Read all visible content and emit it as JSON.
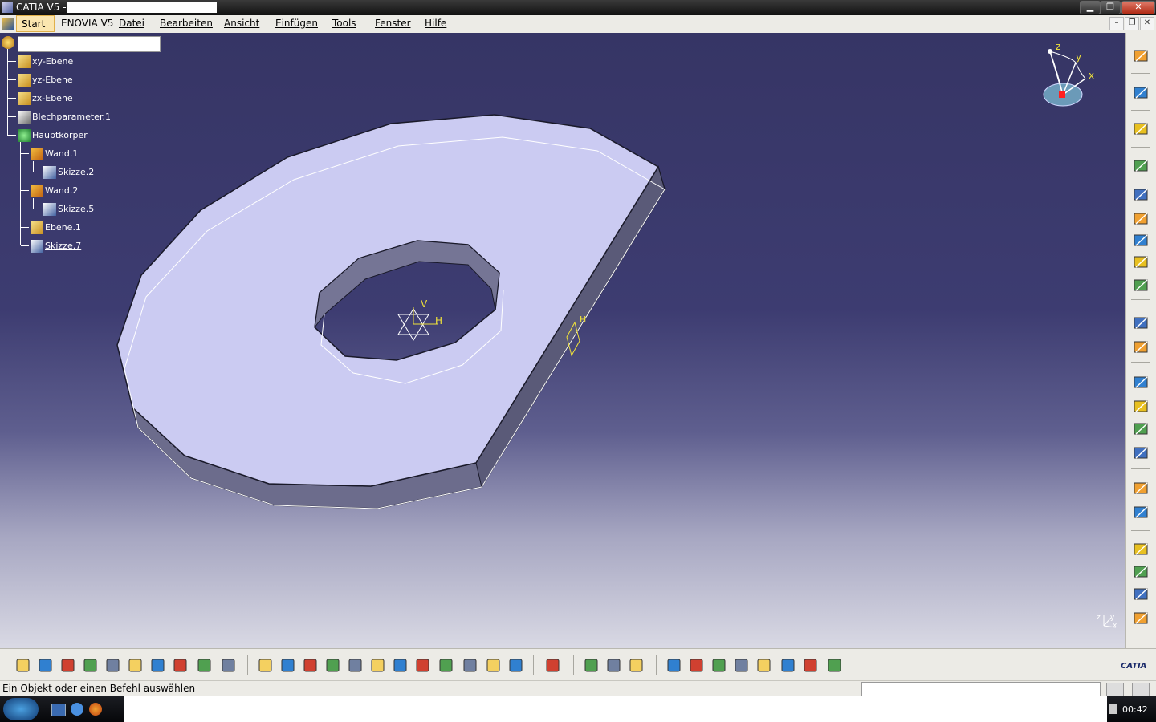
{
  "window": {
    "title": "CATIA V5 -",
    "buttons": {
      "minimize": "▁",
      "restore": "❐",
      "close": "✕"
    }
  },
  "menu": {
    "items": [
      "Start",
      "ENOVIA V5",
      "Datei",
      "Bearbeiten",
      "Ansicht",
      "Einfügen",
      "Tools",
      "Fenster",
      "Hilfe"
    ],
    "inner_buttons": [
      "–",
      "❐",
      "✕"
    ]
  },
  "tree": {
    "root_label": "",
    "items": [
      {
        "label": "xy-Ebene",
        "icon": "plane-icon",
        "level": 1
      },
      {
        "label": "yz-Ebene",
        "icon": "plane-icon",
        "level": 1
      },
      {
        "label": "zx-Ebene",
        "icon": "plane-icon",
        "level": 1
      },
      {
        "label": "Blechparameter.1",
        "icon": "sheetmetal-parameters-icon",
        "level": 1
      },
      {
        "label": "Hauptkörper",
        "icon": "body-icon",
        "level": 1
      },
      {
        "label": "Wand.1",
        "icon": "wall-icon",
        "level": 2
      },
      {
        "label": "Skizze.2",
        "icon": "sketch-icon",
        "level": 3
      },
      {
        "label": "Wand.2",
        "icon": "wall-icon",
        "level": 2
      },
      {
        "label": "Skizze.5",
        "icon": "sketch-icon",
        "level": 3
      },
      {
        "label": "Ebene.1",
        "icon": "plane-icon",
        "level": 2
      },
      {
        "label": "Skizze.7",
        "icon": "sketch-icon",
        "level": 2
      }
    ]
  },
  "compass": {
    "x": "x",
    "y": "y",
    "z": "z"
  },
  "sketch_axes": {
    "v": "V",
    "h": "H"
  },
  "mini_axes": {
    "z": "z",
    "y": "y",
    "x": "x"
  },
  "status": {
    "text": "Ein Objekt oder einen Befehl auswählen"
  },
  "brand": {
    "logo_text": "CATIA"
  },
  "taskbar": {
    "clock": "00:42"
  },
  "colors": {
    "viewport_top": "#363565",
    "part_face": "#cbcbf2",
    "part_side": "#6e6e8e",
    "selection_yellow": "#f0e23a"
  }
}
